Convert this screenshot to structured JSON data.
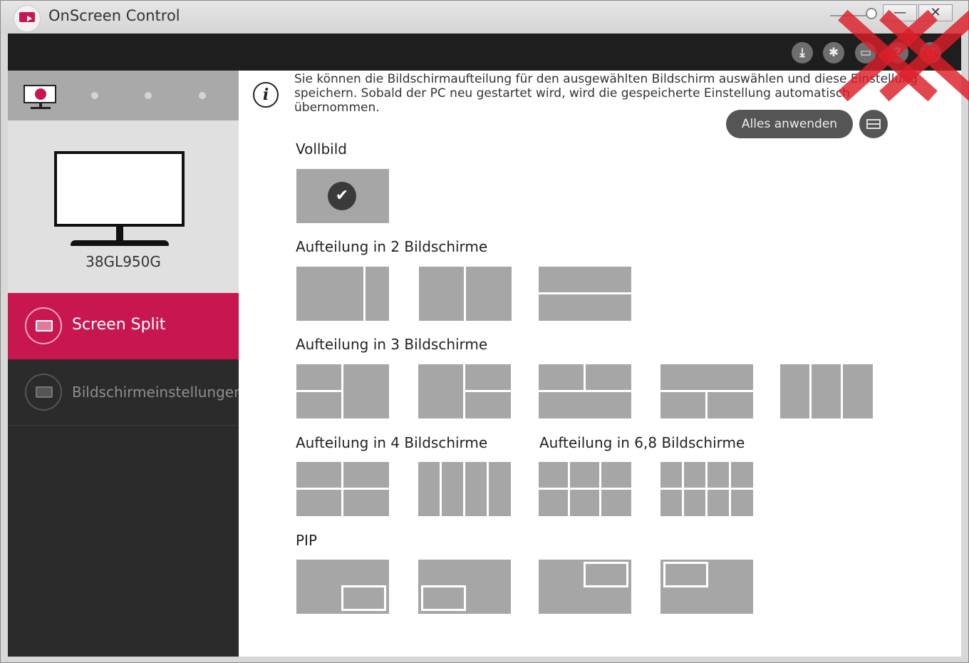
{
  "window": {
    "title": "OnScreen Control",
    "minimize_glyph": "—",
    "close_glyph": "✕"
  },
  "toolbar": {
    "icons": [
      "download-icon",
      "cursor-icon",
      "monitor-icon",
      "help-icon",
      "gear-icon"
    ],
    "help_glyph": "?"
  },
  "sidebar": {
    "monitor_model": "38GL950G",
    "menu": [
      {
        "label": "Screen Split",
        "active": true
      },
      {
        "label": "Bildschirmeinstellungen",
        "active": false
      }
    ]
  },
  "content": {
    "info_text": "Sie können die Bildschirmaufteilung für den ausgewählten Bildschirm auswählen und diese Einstellung speichern. Sobald der PC neu gestartet wird, wird die gespeicherte Einstellung automatisch übernommen.",
    "apply_label": "Alles anwenden",
    "sections": {
      "fullscreen": "Vollbild",
      "split2": "Aufteilung in 2 Bildschirme",
      "split3": "Aufteilung in 3 Bildschirme",
      "split4": "Aufteilung in 4 Bildschirme",
      "split68": "Aufteilung in 6,8 Bildschirme",
      "pip": "PIP"
    },
    "selected_layout": "fullscreen"
  },
  "colors": {
    "accent": "#c8174f",
    "tile": "#a6a6a6",
    "dark": "#2b2b2b"
  }
}
